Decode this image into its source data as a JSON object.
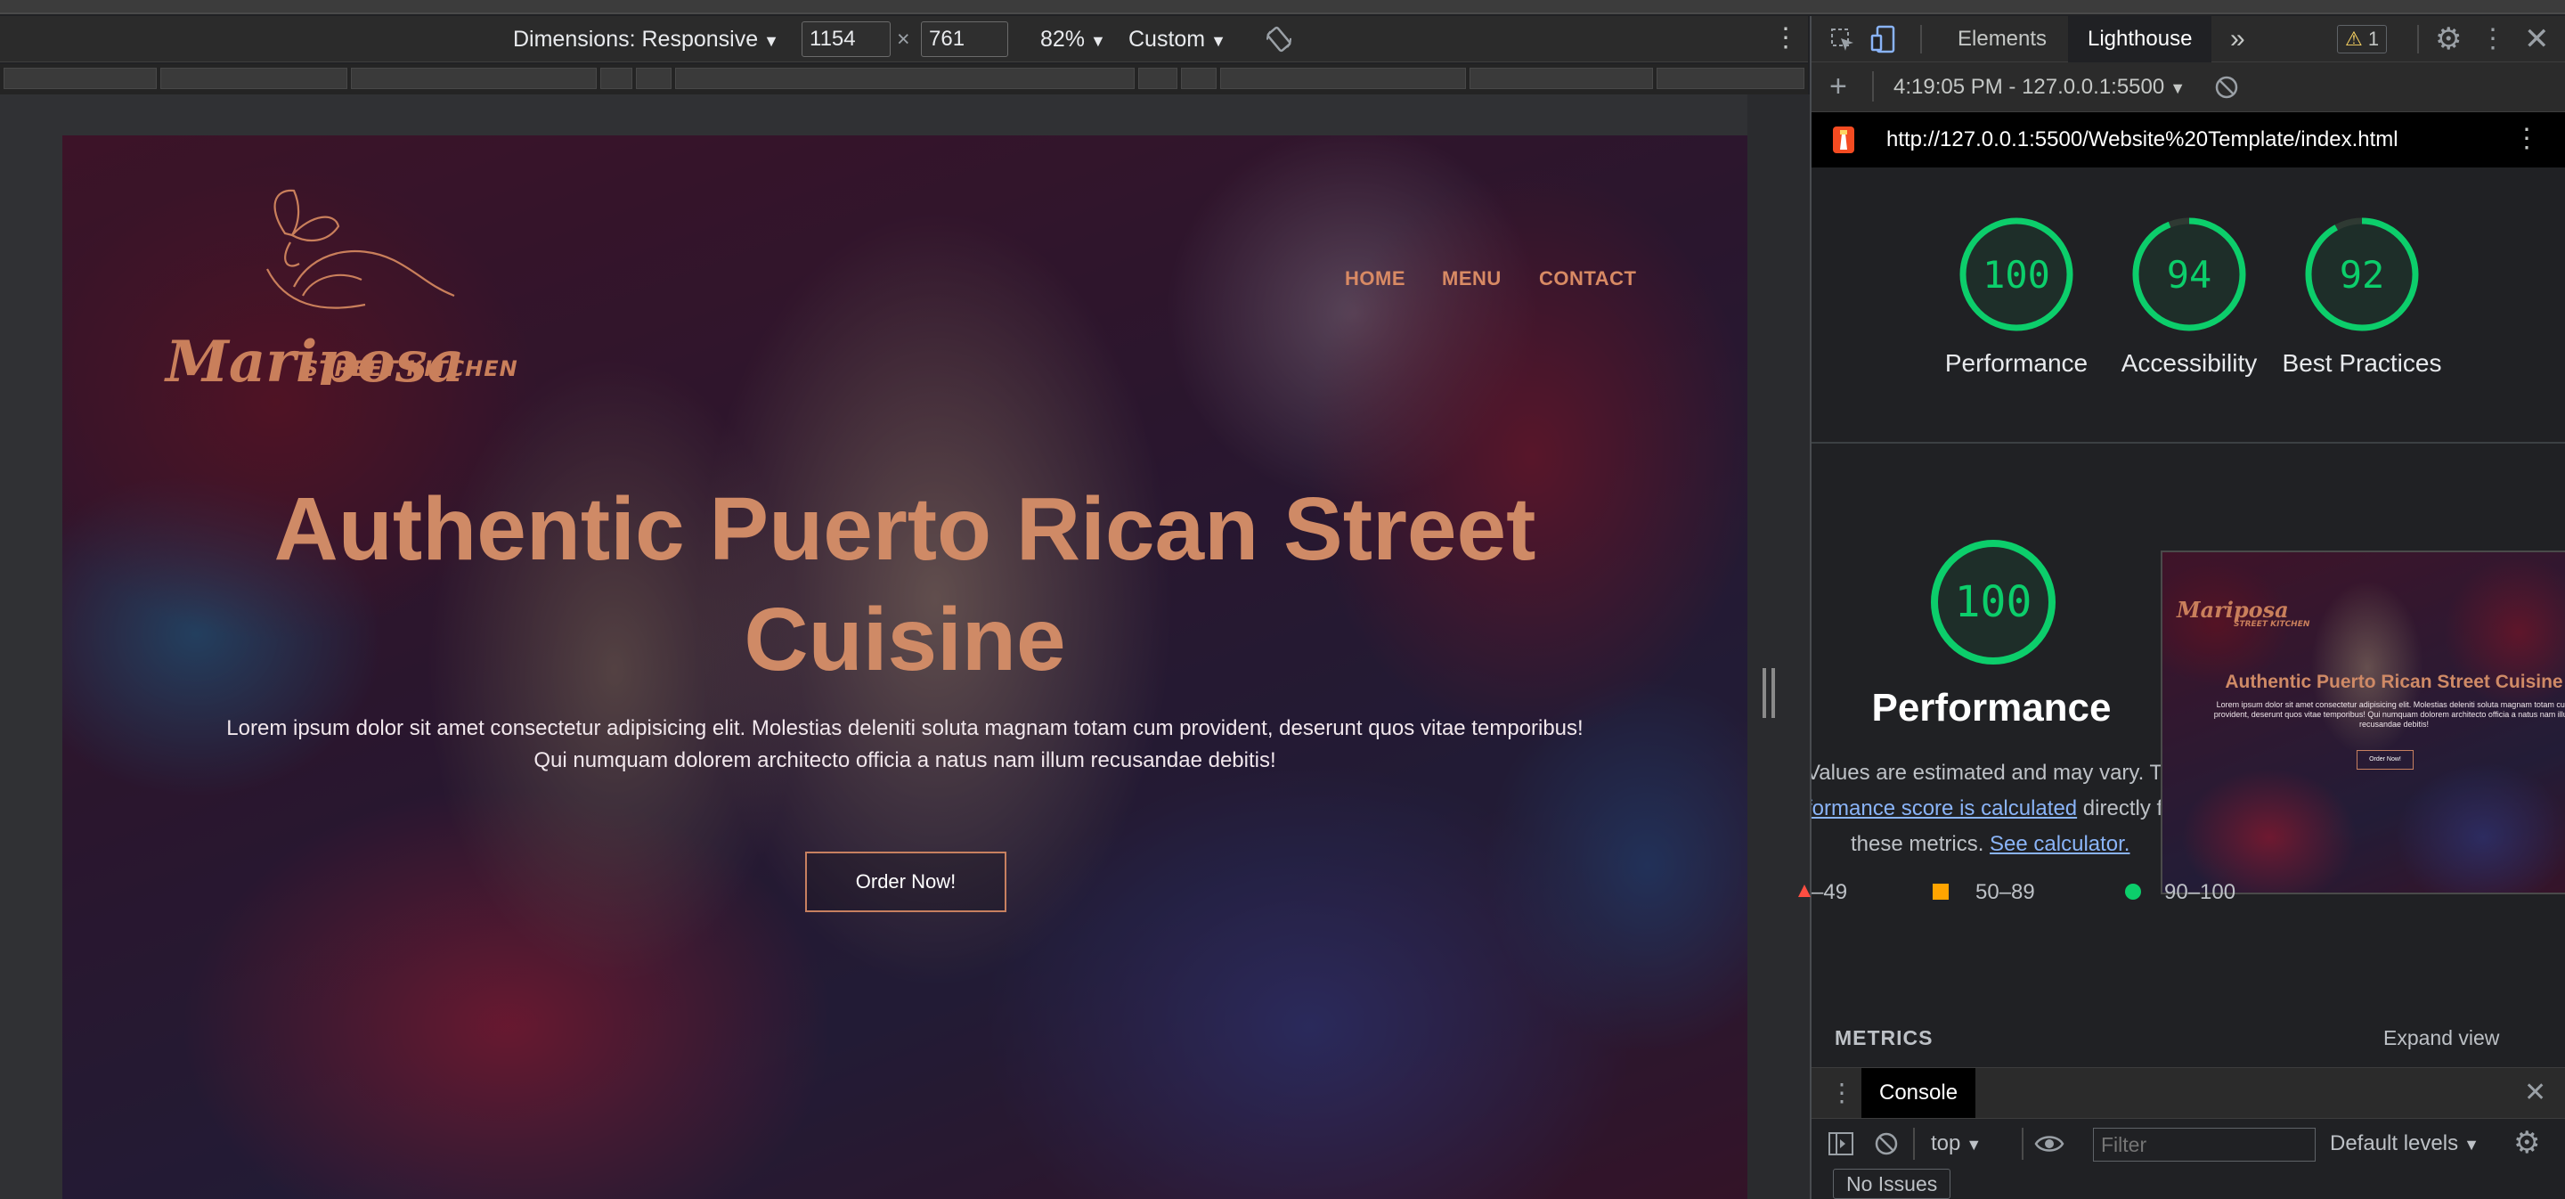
{
  "device_toolbar": {
    "dimensions_label": "Dimensions: Responsive",
    "width": "1154",
    "times": "×",
    "height": "761",
    "zoom": "82%",
    "throttle": "Custom"
  },
  "site": {
    "logo_name": "Mariposa",
    "logo_tagline": "Street Kitchen",
    "nav": [
      "HOME",
      "MENU",
      "CONTACT"
    ],
    "hero_title": "Authentic Puerto Rican Street Cuisine",
    "hero_text": "Lorem ipsum dolor sit amet consectetur adipisicing elit. Molestias deleniti soluta magnam totam cum provident, deserunt quos vitae temporibus! Qui numquam dolorem architecto officia a natus nam illum recusandae debitis!",
    "order_button": "Order Now!"
  },
  "devtools": {
    "tabs": [
      "Elements",
      "Lighthouse"
    ],
    "warning_count": "1",
    "report_time": "4:19:05 PM - 127.0.0.1:5500",
    "url": "http://127.0.0.1:5500/Website%20Template/index.html",
    "scores": [
      {
        "label": "Performance",
        "value": 100
      },
      {
        "label": "Accessibility",
        "value": 94
      },
      {
        "label": "Best Practices",
        "value": 92
      }
    ],
    "perf_big_score": "100",
    "perf_title": "Performance",
    "perf_desc_1": "Values are estimated and may vary. Th",
    "perf_desc_link1": "formance score is calculated",
    "perf_desc_2": " directly f",
    "perf_desc_3": "these metrics. ",
    "perf_desc_link2": "See calculator.",
    "legend": [
      "–49",
      "50–89",
      "90–100"
    ],
    "colors": {
      "pass": "#0cce6b",
      "average": "#ffa400",
      "fail": "#ff4e42"
    },
    "metrics_label": "METRICS",
    "expand_view": "Expand view",
    "thumb": {
      "logo": "Mariposa",
      "tagline": "Street Kitchen",
      "title": "Authentic Puerto Rican Street Cuisine",
      "text": "Lorem ipsum dolor sit amet consectetur adipisicing elit. Molestias deleniti soluta magnam totam cum provident, deserunt quos vitae temporibus! Qui numquam dolorem architecto officia a natus nam illum recusandae debitis!",
      "button": "Order Now!"
    }
  },
  "console": {
    "tab": "Console",
    "context": "top",
    "filter_placeholder": "Filter",
    "levels": "Default levels",
    "issues": "No Issues"
  }
}
